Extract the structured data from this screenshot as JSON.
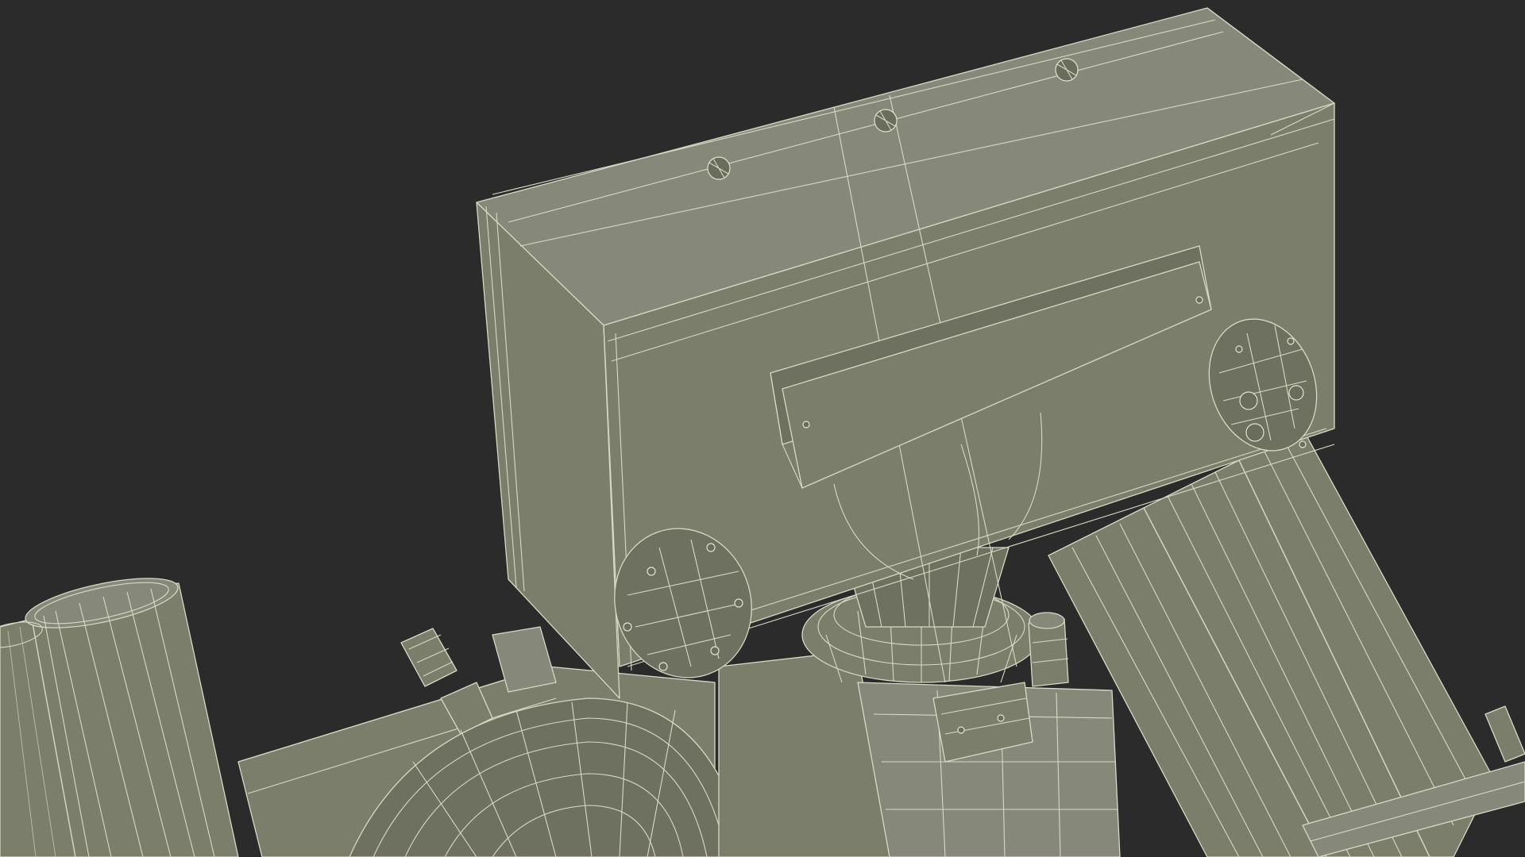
{
  "scene": {
    "background": "#2b2b2b",
    "model_fill": "#7c7e6c",
    "wire_color": "#d8d9c4"
  }
}
